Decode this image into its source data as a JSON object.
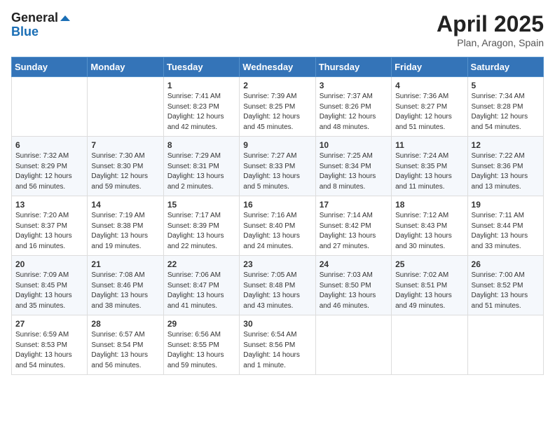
{
  "header": {
    "logo_general": "General",
    "logo_blue": "Blue",
    "month_title": "April 2025",
    "location": "Plan, Aragon, Spain"
  },
  "weekdays": [
    "Sunday",
    "Monday",
    "Tuesday",
    "Wednesday",
    "Thursday",
    "Friday",
    "Saturday"
  ],
  "weeks": [
    [
      {
        "day": "",
        "sunrise": "",
        "sunset": "",
        "daylight": ""
      },
      {
        "day": "",
        "sunrise": "",
        "sunset": "",
        "daylight": ""
      },
      {
        "day": "1",
        "sunrise": "Sunrise: 7:41 AM",
        "sunset": "Sunset: 8:23 PM",
        "daylight": "Daylight: 12 hours and 42 minutes."
      },
      {
        "day": "2",
        "sunrise": "Sunrise: 7:39 AM",
        "sunset": "Sunset: 8:25 PM",
        "daylight": "Daylight: 12 hours and 45 minutes."
      },
      {
        "day": "3",
        "sunrise": "Sunrise: 7:37 AM",
        "sunset": "Sunset: 8:26 PM",
        "daylight": "Daylight: 12 hours and 48 minutes."
      },
      {
        "day": "4",
        "sunrise": "Sunrise: 7:36 AM",
        "sunset": "Sunset: 8:27 PM",
        "daylight": "Daylight: 12 hours and 51 minutes."
      },
      {
        "day": "5",
        "sunrise": "Sunrise: 7:34 AM",
        "sunset": "Sunset: 8:28 PM",
        "daylight": "Daylight: 12 hours and 54 minutes."
      }
    ],
    [
      {
        "day": "6",
        "sunrise": "Sunrise: 7:32 AM",
        "sunset": "Sunset: 8:29 PM",
        "daylight": "Daylight: 12 hours and 56 minutes."
      },
      {
        "day": "7",
        "sunrise": "Sunrise: 7:30 AM",
        "sunset": "Sunset: 8:30 PM",
        "daylight": "Daylight: 12 hours and 59 minutes."
      },
      {
        "day": "8",
        "sunrise": "Sunrise: 7:29 AM",
        "sunset": "Sunset: 8:31 PM",
        "daylight": "Daylight: 13 hours and 2 minutes."
      },
      {
        "day": "9",
        "sunrise": "Sunrise: 7:27 AM",
        "sunset": "Sunset: 8:33 PM",
        "daylight": "Daylight: 13 hours and 5 minutes."
      },
      {
        "day": "10",
        "sunrise": "Sunrise: 7:25 AM",
        "sunset": "Sunset: 8:34 PM",
        "daylight": "Daylight: 13 hours and 8 minutes."
      },
      {
        "day": "11",
        "sunrise": "Sunrise: 7:24 AM",
        "sunset": "Sunset: 8:35 PM",
        "daylight": "Daylight: 13 hours and 11 minutes."
      },
      {
        "day": "12",
        "sunrise": "Sunrise: 7:22 AM",
        "sunset": "Sunset: 8:36 PM",
        "daylight": "Daylight: 13 hours and 13 minutes."
      }
    ],
    [
      {
        "day": "13",
        "sunrise": "Sunrise: 7:20 AM",
        "sunset": "Sunset: 8:37 PM",
        "daylight": "Daylight: 13 hours and 16 minutes."
      },
      {
        "day": "14",
        "sunrise": "Sunrise: 7:19 AM",
        "sunset": "Sunset: 8:38 PM",
        "daylight": "Daylight: 13 hours and 19 minutes."
      },
      {
        "day": "15",
        "sunrise": "Sunrise: 7:17 AM",
        "sunset": "Sunset: 8:39 PM",
        "daylight": "Daylight: 13 hours and 22 minutes."
      },
      {
        "day": "16",
        "sunrise": "Sunrise: 7:16 AM",
        "sunset": "Sunset: 8:40 PM",
        "daylight": "Daylight: 13 hours and 24 minutes."
      },
      {
        "day": "17",
        "sunrise": "Sunrise: 7:14 AM",
        "sunset": "Sunset: 8:42 PM",
        "daylight": "Daylight: 13 hours and 27 minutes."
      },
      {
        "day": "18",
        "sunrise": "Sunrise: 7:12 AM",
        "sunset": "Sunset: 8:43 PM",
        "daylight": "Daylight: 13 hours and 30 minutes."
      },
      {
        "day": "19",
        "sunrise": "Sunrise: 7:11 AM",
        "sunset": "Sunset: 8:44 PM",
        "daylight": "Daylight: 13 hours and 33 minutes."
      }
    ],
    [
      {
        "day": "20",
        "sunrise": "Sunrise: 7:09 AM",
        "sunset": "Sunset: 8:45 PM",
        "daylight": "Daylight: 13 hours and 35 minutes."
      },
      {
        "day": "21",
        "sunrise": "Sunrise: 7:08 AM",
        "sunset": "Sunset: 8:46 PM",
        "daylight": "Daylight: 13 hours and 38 minutes."
      },
      {
        "day": "22",
        "sunrise": "Sunrise: 7:06 AM",
        "sunset": "Sunset: 8:47 PM",
        "daylight": "Daylight: 13 hours and 41 minutes."
      },
      {
        "day": "23",
        "sunrise": "Sunrise: 7:05 AM",
        "sunset": "Sunset: 8:48 PM",
        "daylight": "Daylight: 13 hours and 43 minutes."
      },
      {
        "day": "24",
        "sunrise": "Sunrise: 7:03 AM",
        "sunset": "Sunset: 8:50 PM",
        "daylight": "Daylight: 13 hours and 46 minutes."
      },
      {
        "day": "25",
        "sunrise": "Sunrise: 7:02 AM",
        "sunset": "Sunset: 8:51 PM",
        "daylight": "Daylight: 13 hours and 49 minutes."
      },
      {
        "day": "26",
        "sunrise": "Sunrise: 7:00 AM",
        "sunset": "Sunset: 8:52 PM",
        "daylight": "Daylight: 13 hours and 51 minutes."
      }
    ],
    [
      {
        "day": "27",
        "sunrise": "Sunrise: 6:59 AM",
        "sunset": "Sunset: 8:53 PM",
        "daylight": "Daylight: 13 hours and 54 minutes."
      },
      {
        "day": "28",
        "sunrise": "Sunrise: 6:57 AM",
        "sunset": "Sunset: 8:54 PM",
        "daylight": "Daylight: 13 hours and 56 minutes."
      },
      {
        "day": "29",
        "sunrise": "Sunrise: 6:56 AM",
        "sunset": "Sunset: 8:55 PM",
        "daylight": "Daylight: 13 hours and 59 minutes."
      },
      {
        "day": "30",
        "sunrise": "Sunrise: 6:54 AM",
        "sunset": "Sunset: 8:56 PM",
        "daylight": "Daylight: 14 hours and 1 minute."
      },
      {
        "day": "",
        "sunrise": "",
        "sunset": "",
        "daylight": ""
      },
      {
        "day": "",
        "sunrise": "",
        "sunset": "",
        "daylight": ""
      },
      {
        "day": "",
        "sunrise": "",
        "sunset": "",
        "daylight": ""
      }
    ]
  ]
}
